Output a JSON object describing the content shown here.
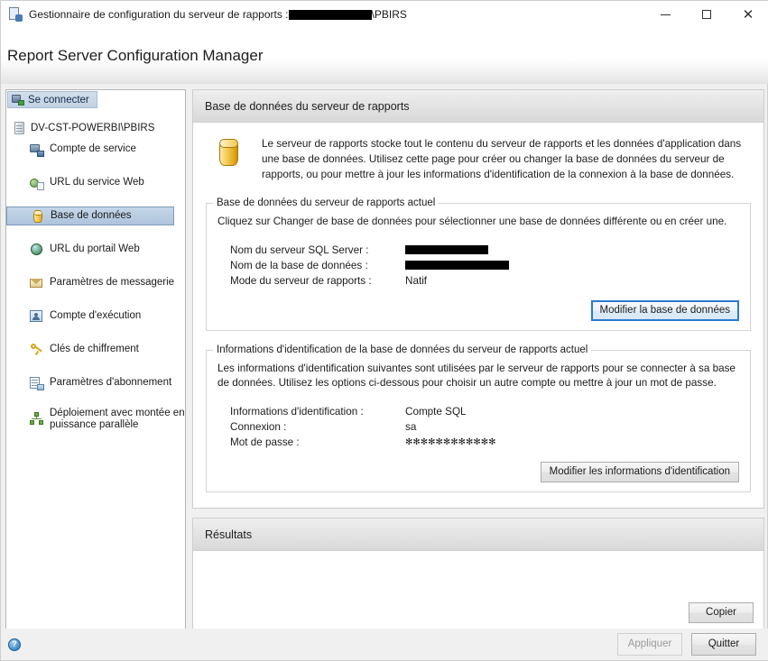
{
  "window": {
    "title_prefix": "Gestionnaire de configuration du serveur de rapports :",
    "title_suffix": "\\PBIRS",
    "title_redacted": true,
    "icon": "report-server-icon",
    "minimize_label": "Réduire",
    "maximize_label": "Agrandir",
    "close_label": "Fermer"
  },
  "app_header": {
    "title": "Report Server Configuration Manager"
  },
  "sidebar": {
    "connect_button": "Se connecter",
    "root_node": "DV-CST-POWERBI\\PBIRS",
    "items": [
      {
        "label": "Compte de service",
        "icon": "service-account-icon",
        "selected": false
      },
      {
        "label": "URL du service Web",
        "icon": "web-service-url-icon",
        "selected": false
      },
      {
        "label": "Base de données",
        "icon": "database-icon",
        "selected": true
      },
      {
        "label": "URL du portail Web",
        "icon": "web-portal-url-icon",
        "selected": false
      },
      {
        "label": "Paramètres de messagerie",
        "icon": "email-settings-icon",
        "selected": false
      },
      {
        "label": "Compte d'exécution",
        "icon": "execution-account-icon",
        "selected": false
      },
      {
        "label": "Clés de chiffrement",
        "icon": "encryption-keys-icon",
        "selected": false
      },
      {
        "label": "Paramètres d'abonnement",
        "icon": "subscription-settings-icon",
        "selected": false
      },
      {
        "label": "Déploiement avec montée en puissance parallèle",
        "icon": "scale-out-deployment-icon",
        "selected": false
      }
    ]
  },
  "main": {
    "panel_title": "Base de données du serveur de rapports",
    "intro_icon": "database-cylinder-icon",
    "intro_text": "Le serveur de rapports stocke tout le contenu du serveur de rapports et les données d'application dans une base de données. Utilisez cette page pour créer ou changer la base de données du serveur de rapports, ou pour mettre à jour les informations d'identification de la connexion à la base de données.",
    "current_db": {
      "group_title": "Base de données du serveur de rapports actuel",
      "description": "Cliquez sur Changer de base de données pour sélectionner une base de données différente ou en créer une.",
      "rows": [
        {
          "key": "Nom du serveur SQL Server :",
          "value": "",
          "redacted": true,
          "redact_width": 92
        },
        {
          "key": "Nom de la base de données :",
          "value": "",
          "redacted": true,
          "redact_width": 115
        },
        {
          "key": "Mode du serveur de rapports :",
          "value": "Natif",
          "redacted": false
        }
      ],
      "button": "Modifier la base de données",
      "button_focused": true
    },
    "credentials": {
      "group_title": "Informations d'identification de la base de données du serveur de rapports actuel",
      "description": "Les informations d'identification suivantes sont utilisées par le serveur de rapports pour se connecter à sa base de données. Utilisez les options ci-dessous pour choisir un autre compte ou mettre à jour un mot de passe.",
      "rows": [
        {
          "key": "Informations d'identification :",
          "value": "Compte SQL"
        },
        {
          "key": "Connexion :",
          "value": "sa"
        },
        {
          "key": "Mot de passe :",
          "value": "✻✻✻✻✻✻✻✻✻✻✻✻"
        }
      ],
      "button": "Modifier les informations d'identification",
      "button_focused": false
    }
  },
  "results": {
    "panel_title": "Résultats",
    "content": "",
    "copy_button": "Copier"
  },
  "bottom_bar": {
    "help_icon": "help-icon",
    "help_glyph": "?",
    "apply_button": "Appliquer",
    "apply_disabled": true,
    "quit_button": "Quitter"
  },
  "colors": {
    "selection_blue": "#aec4dc",
    "focus_blue": "#2a7ad1",
    "panel_header_gray": "#d8d8d8",
    "redaction_black": "#000000"
  }
}
